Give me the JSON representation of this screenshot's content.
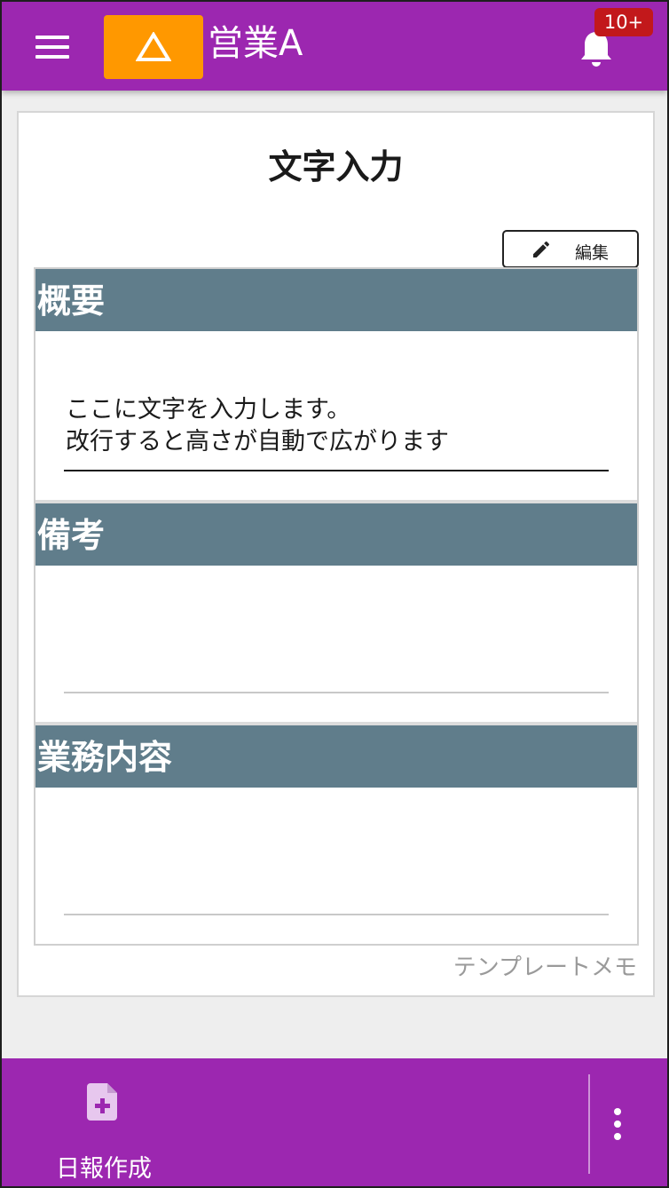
{
  "header": {
    "title": "営業A",
    "notification_count": "10+",
    "menu_icon": "hamburger-menu-icon",
    "warning_icon": "warning-triangle-icon",
    "bell_icon": "bell-icon"
  },
  "card": {
    "title": "文字入力",
    "edit_label": "編集",
    "edit_icon": "pencil-icon",
    "sections": [
      {
        "heading": "概要",
        "lines": [
          "ここに文字を入力します。",
          "改行すると高さが自動で広がります"
        ]
      },
      {
        "heading": "備考",
        "lines": []
      },
      {
        "heading": "業務内容",
        "lines": []
      }
    ],
    "footer_note": "テンプレートメモ"
  },
  "bottom_bar": {
    "create_label": "日報作成",
    "create_icon": "add-document-icon",
    "more_icon": "more-vertical-icon"
  },
  "colors": {
    "primary": "#9c27b0",
    "warning": "#ff9800",
    "badge": "#c2181b",
    "section_header": "#607d8b"
  }
}
